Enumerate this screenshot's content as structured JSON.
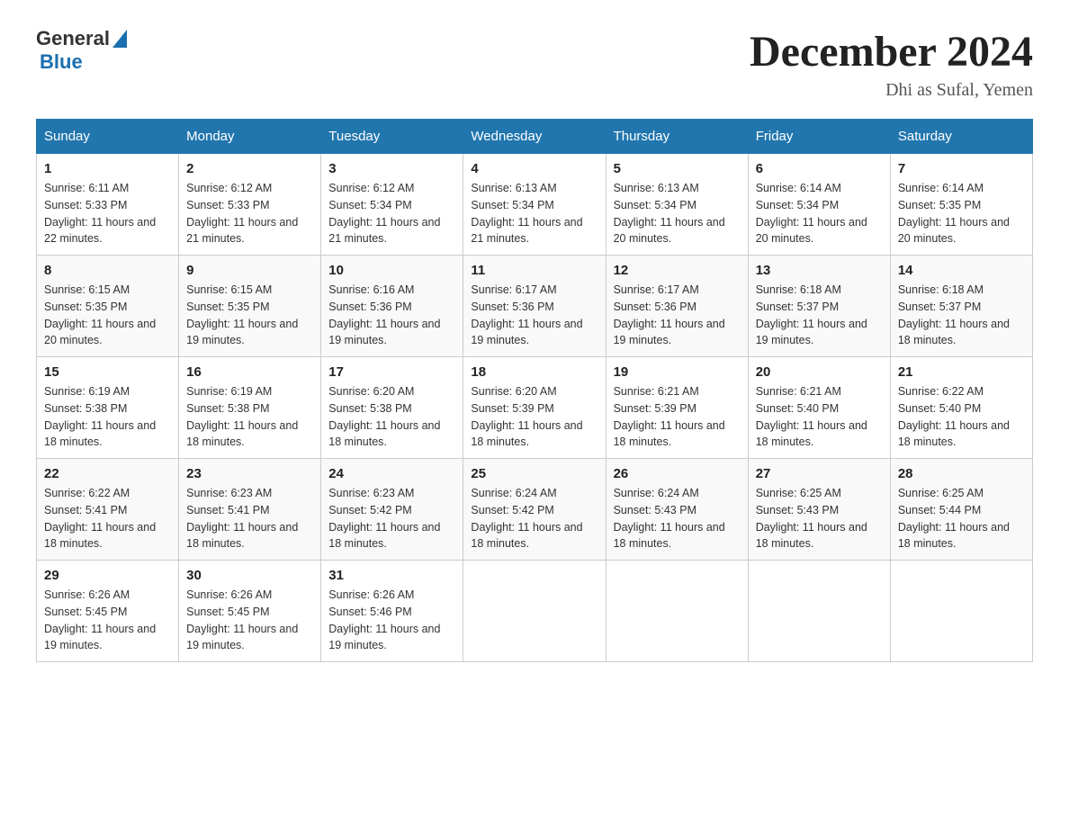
{
  "header": {
    "logo_general": "General",
    "logo_blue": "Blue",
    "title": "December 2024",
    "subtitle": "Dhi as Sufal, Yemen"
  },
  "days_of_week": [
    "Sunday",
    "Monday",
    "Tuesday",
    "Wednesday",
    "Thursday",
    "Friday",
    "Saturday"
  ],
  "weeks": [
    [
      {
        "day": "1",
        "sunrise": "Sunrise: 6:11 AM",
        "sunset": "Sunset: 5:33 PM",
        "daylight": "Daylight: 11 hours and 22 minutes."
      },
      {
        "day": "2",
        "sunrise": "Sunrise: 6:12 AM",
        "sunset": "Sunset: 5:33 PM",
        "daylight": "Daylight: 11 hours and 21 minutes."
      },
      {
        "day": "3",
        "sunrise": "Sunrise: 6:12 AM",
        "sunset": "Sunset: 5:34 PM",
        "daylight": "Daylight: 11 hours and 21 minutes."
      },
      {
        "day": "4",
        "sunrise": "Sunrise: 6:13 AM",
        "sunset": "Sunset: 5:34 PM",
        "daylight": "Daylight: 11 hours and 21 minutes."
      },
      {
        "day": "5",
        "sunrise": "Sunrise: 6:13 AM",
        "sunset": "Sunset: 5:34 PM",
        "daylight": "Daylight: 11 hours and 20 minutes."
      },
      {
        "day": "6",
        "sunrise": "Sunrise: 6:14 AM",
        "sunset": "Sunset: 5:34 PM",
        "daylight": "Daylight: 11 hours and 20 minutes."
      },
      {
        "day": "7",
        "sunrise": "Sunrise: 6:14 AM",
        "sunset": "Sunset: 5:35 PM",
        "daylight": "Daylight: 11 hours and 20 minutes."
      }
    ],
    [
      {
        "day": "8",
        "sunrise": "Sunrise: 6:15 AM",
        "sunset": "Sunset: 5:35 PM",
        "daylight": "Daylight: 11 hours and 20 minutes."
      },
      {
        "day": "9",
        "sunrise": "Sunrise: 6:15 AM",
        "sunset": "Sunset: 5:35 PM",
        "daylight": "Daylight: 11 hours and 19 minutes."
      },
      {
        "day": "10",
        "sunrise": "Sunrise: 6:16 AM",
        "sunset": "Sunset: 5:36 PM",
        "daylight": "Daylight: 11 hours and 19 minutes."
      },
      {
        "day": "11",
        "sunrise": "Sunrise: 6:17 AM",
        "sunset": "Sunset: 5:36 PM",
        "daylight": "Daylight: 11 hours and 19 minutes."
      },
      {
        "day": "12",
        "sunrise": "Sunrise: 6:17 AM",
        "sunset": "Sunset: 5:36 PM",
        "daylight": "Daylight: 11 hours and 19 minutes."
      },
      {
        "day": "13",
        "sunrise": "Sunrise: 6:18 AM",
        "sunset": "Sunset: 5:37 PM",
        "daylight": "Daylight: 11 hours and 19 minutes."
      },
      {
        "day": "14",
        "sunrise": "Sunrise: 6:18 AM",
        "sunset": "Sunset: 5:37 PM",
        "daylight": "Daylight: 11 hours and 18 minutes."
      }
    ],
    [
      {
        "day": "15",
        "sunrise": "Sunrise: 6:19 AM",
        "sunset": "Sunset: 5:38 PM",
        "daylight": "Daylight: 11 hours and 18 minutes."
      },
      {
        "day": "16",
        "sunrise": "Sunrise: 6:19 AM",
        "sunset": "Sunset: 5:38 PM",
        "daylight": "Daylight: 11 hours and 18 minutes."
      },
      {
        "day": "17",
        "sunrise": "Sunrise: 6:20 AM",
        "sunset": "Sunset: 5:38 PM",
        "daylight": "Daylight: 11 hours and 18 minutes."
      },
      {
        "day": "18",
        "sunrise": "Sunrise: 6:20 AM",
        "sunset": "Sunset: 5:39 PM",
        "daylight": "Daylight: 11 hours and 18 minutes."
      },
      {
        "day": "19",
        "sunrise": "Sunrise: 6:21 AM",
        "sunset": "Sunset: 5:39 PM",
        "daylight": "Daylight: 11 hours and 18 minutes."
      },
      {
        "day": "20",
        "sunrise": "Sunrise: 6:21 AM",
        "sunset": "Sunset: 5:40 PM",
        "daylight": "Daylight: 11 hours and 18 minutes."
      },
      {
        "day": "21",
        "sunrise": "Sunrise: 6:22 AM",
        "sunset": "Sunset: 5:40 PM",
        "daylight": "Daylight: 11 hours and 18 minutes."
      }
    ],
    [
      {
        "day": "22",
        "sunrise": "Sunrise: 6:22 AM",
        "sunset": "Sunset: 5:41 PM",
        "daylight": "Daylight: 11 hours and 18 minutes."
      },
      {
        "day": "23",
        "sunrise": "Sunrise: 6:23 AM",
        "sunset": "Sunset: 5:41 PM",
        "daylight": "Daylight: 11 hours and 18 minutes."
      },
      {
        "day": "24",
        "sunrise": "Sunrise: 6:23 AM",
        "sunset": "Sunset: 5:42 PM",
        "daylight": "Daylight: 11 hours and 18 minutes."
      },
      {
        "day": "25",
        "sunrise": "Sunrise: 6:24 AM",
        "sunset": "Sunset: 5:42 PM",
        "daylight": "Daylight: 11 hours and 18 minutes."
      },
      {
        "day": "26",
        "sunrise": "Sunrise: 6:24 AM",
        "sunset": "Sunset: 5:43 PM",
        "daylight": "Daylight: 11 hours and 18 minutes."
      },
      {
        "day": "27",
        "sunrise": "Sunrise: 6:25 AM",
        "sunset": "Sunset: 5:43 PM",
        "daylight": "Daylight: 11 hours and 18 minutes."
      },
      {
        "day": "28",
        "sunrise": "Sunrise: 6:25 AM",
        "sunset": "Sunset: 5:44 PM",
        "daylight": "Daylight: 11 hours and 18 minutes."
      }
    ],
    [
      {
        "day": "29",
        "sunrise": "Sunrise: 6:26 AM",
        "sunset": "Sunset: 5:45 PM",
        "daylight": "Daylight: 11 hours and 19 minutes."
      },
      {
        "day": "30",
        "sunrise": "Sunrise: 6:26 AM",
        "sunset": "Sunset: 5:45 PM",
        "daylight": "Daylight: 11 hours and 19 minutes."
      },
      {
        "day": "31",
        "sunrise": "Sunrise: 6:26 AM",
        "sunset": "Sunset: 5:46 PM",
        "daylight": "Daylight: 11 hours and 19 minutes."
      },
      {
        "day": "",
        "sunrise": "",
        "sunset": "",
        "daylight": ""
      },
      {
        "day": "",
        "sunrise": "",
        "sunset": "",
        "daylight": ""
      },
      {
        "day": "",
        "sunrise": "",
        "sunset": "",
        "daylight": ""
      },
      {
        "day": "",
        "sunrise": "",
        "sunset": "",
        "daylight": ""
      }
    ]
  ],
  "colors": {
    "header_bg": "#2176ae",
    "header_text": "#ffffff",
    "border": "#9bbbd4"
  }
}
